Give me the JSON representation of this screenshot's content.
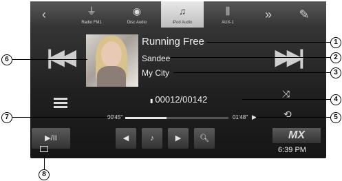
{
  "sources": [
    {
      "label": "Radio FM1",
      "icon": "antenna-icon"
    },
    {
      "label": "Disc Audio",
      "icon": "disc-icon"
    },
    {
      "label": "iPod Audio",
      "icon": "music-note-icon"
    },
    {
      "label": "AUX-1",
      "icon": "aux-icon"
    }
  ],
  "track": {
    "title": "Running Free",
    "artist": "Sandee",
    "album": "My City",
    "count": "00012/00142"
  },
  "time": {
    "elapsed": "00'45\"",
    "remaining": "01'48\"",
    "progress": 0.4
  },
  "controls": {
    "play_pause": "▶/II"
  },
  "brand": "MX",
  "clock": "6:39 PM",
  "callouts": [
    "1",
    "2",
    "3",
    "4",
    "5",
    "6",
    "7",
    "8"
  ]
}
